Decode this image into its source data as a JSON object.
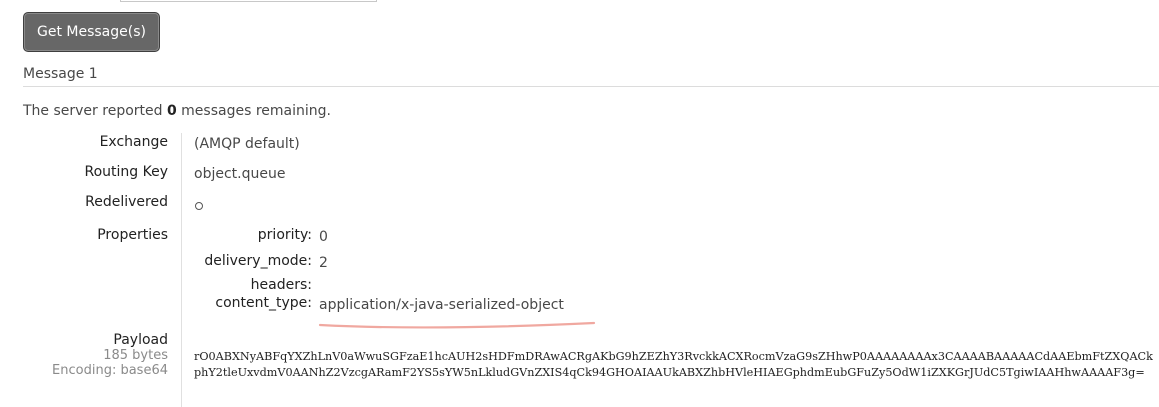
{
  "toolbar": {
    "get_button_label": "Get Message(s)"
  },
  "message": {
    "title": "Message 1",
    "server_note_prefix": "The server reported ",
    "remaining_count": "0",
    "server_note_suffix": " messages remaining.",
    "fields": {
      "exchange_label": "Exchange",
      "exchange_value": "(AMQP default)",
      "routing_key_label": "Routing Key",
      "routing_key_value": "object.queue",
      "redelivered_label": "Redelivered",
      "redelivered_icon": "circle-outline-icon",
      "properties_label": "Properties"
    },
    "properties": {
      "priority_key": "priority:",
      "priority_value": "0",
      "delivery_mode_key": "delivery_mode:",
      "delivery_mode_value": "2",
      "headers_key": "headers:",
      "content_type_key": "content_type:",
      "content_type_value": "application/x-java-serialized-object"
    },
    "payload": {
      "label": "Payload",
      "size": "185 bytes",
      "encoding": "Encoding: base64",
      "text": "rO0ABXNyABFqYXZhLnV0aWwuSGFzaE1hcAUH2sHDFmDRAwACRgAKbG9hZEZhY3RvckkACXRocmVzaG9sZHhwP0AAAAAAAAx3CAAAABAAAAACdAAEbmFtZXQACkphY2tleUxvdmV0AANhZ2VzcgARamF2YS5sYW5nLkludGVnZXIS4qCk94GHOAIAAUkABXZhbHVleHIAEGphdmEubGFuZy5OdW1iZXKGrJUdC5TgiwIAAHhwAAAAF3g="
    }
  },
  "colors": {
    "button_bg": "#676767",
    "text": "#484848",
    "annotation_underline": "#f0a8a0"
  }
}
